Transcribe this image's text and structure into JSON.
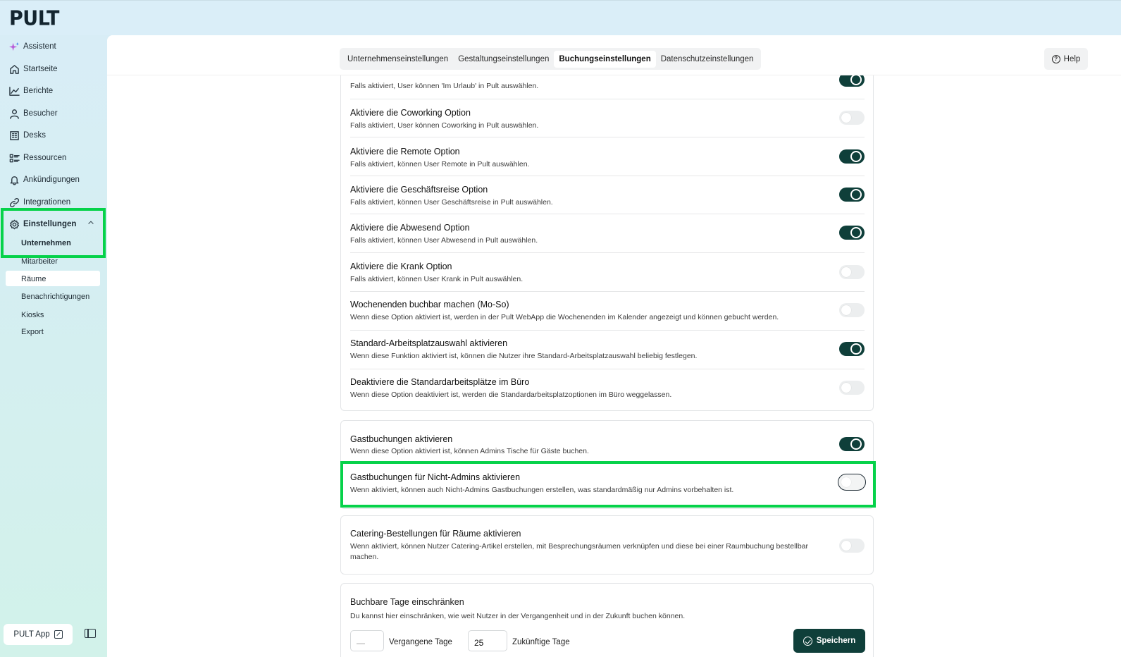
{
  "app": {
    "logo": "PULT"
  },
  "sidebar": {
    "items": [
      {
        "label": "Assistent",
        "icon": "sparkle-icon"
      },
      {
        "label": "Startseite",
        "icon": "home-icon"
      },
      {
        "label": "Berichte",
        "icon": "chart-line-icon"
      },
      {
        "label": "Besucher",
        "icon": "user-icon"
      },
      {
        "label": "Desks",
        "icon": "building-icon"
      },
      {
        "label": "Ressourcen",
        "icon": "list-icon"
      },
      {
        "label": "Ankündigungen",
        "icon": "bell-icon"
      },
      {
        "label": "Integrationen",
        "icon": "link-icon"
      },
      {
        "label": "Einstellungen",
        "icon": "gear-icon"
      }
    ],
    "sub_items": [
      "Unternehmen",
      "Mitarbeiter",
      "Räume",
      "Benachrichtigungen",
      "Kiosks",
      "Export"
    ],
    "pult_app_label": "PULT App"
  },
  "tabs": [
    "Unternehmenseinstellungen",
    "Gestaltungseinstellungen",
    "Buchungseinstellungen",
    "Datenschutzeinstellungen"
  ],
  "active_tab": "Buchungseinstellungen",
  "help_label": "Help",
  "card1": [
    {
      "title": "",
      "desc": "Falls aktiviert, User können 'Im Urlaub' in Pult auswählen.",
      "on": true
    },
    {
      "title": "Aktiviere die Coworking Option",
      "desc": "Falls aktiviert, User können Coworking in Pult auswählen.",
      "on": false
    },
    {
      "title": "Aktiviere die Remote Option",
      "desc": "Falls aktiviert, können User Remote in Pult auswählen.",
      "on": true
    },
    {
      "title": "Aktiviere die Geschäftsreise Option",
      "desc": "Falls aktiviert, können User Geschäftsreise in Pult auswählen.",
      "on": true
    },
    {
      "title": "Aktiviere die Abwesend Option",
      "desc": "Falls aktiviert, können User Abwesend in Pult auswählen.",
      "on": true
    },
    {
      "title": "Aktiviere die Krank Option",
      "desc": "Falls aktiviert, können User Krank in Pult auswählen.",
      "on": false
    },
    {
      "title": "Wochenenden buchbar machen (Mo-So)",
      "desc": "Wenn diese Option aktiviert ist, werden in der Pult WebApp die Wochenenden im Kalender angezeigt und können gebucht werden.",
      "on": false
    },
    {
      "title": "Standard-Arbeitsplatzauswahl aktivieren",
      "desc": "Wenn diese Funktion aktiviert ist, können die Nutzer ihre Standard-Arbeitsplatzauswahl beliebig festlegen.",
      "on": true
    },
    {
      "title": "Deaktiviere die Standardarbeitsplätze im Büro",
      "desc": "Wenn diese Option deaktiviert ist, werden die Standardarbeitsplatzoptionen im Büro weggelassen.",
      "on": false
    }
  ],
  "card2": [
    {
      "title": "Gastbuchungen aktivieren",
      "desc": "Wenn diese Option aktiviert ist, können Admins Tische für Gäste buchen.",
      "on": true
    },
    {
      "title": "Gastbuchungen für Nicht-Admins aktivieren",
      "desc": "Wenn aktiviert, können auch Nicht-Admins Gastbuchungen erstellen, was standardmäßig nur Admins vorbehalten ist.",
      "on": false
    }
  ],
  "card3": {
    "title": "Catering-Bestellungen für Räume aktivieren",
    "desc": "Wenn aktiviert, können Nutzer Catering-Artikel erstellen, mit Besprechungsräumen verknüpfen und diese bei einer Raumbuchung bestellbar machen.",
    "on": false
  },
  "card4": {
    "title": "Buchbare Tage einschränken",
    "desc": "Du kannst hier einschränken, wie weit Nutzer in der Vergangenheit und in der Zukunft buchen können.",
    "past_value": "—",
    "past_label": "Vergangene Tage",
    "future_value": "25",
    "future_label": "Zukünftige Tage",
    "save_label": "Speichern"
  },
  "colors": {
    "accent": "#0f3f3a",
    "highlight": "#06d24a"
  }
}
